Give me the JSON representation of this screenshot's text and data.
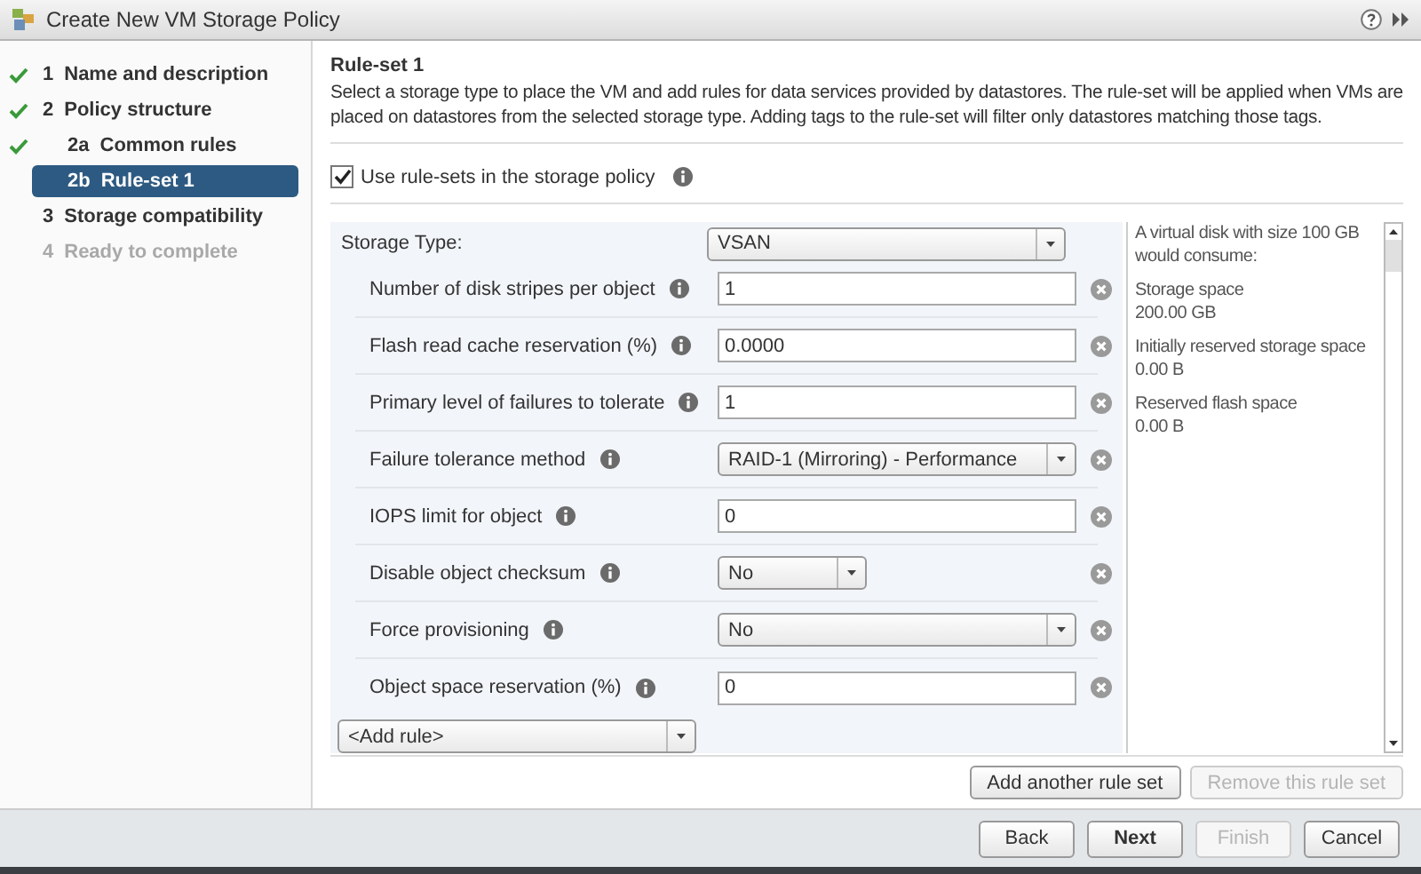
{
  "window": {
    "title": "Create New VM Storage Policy"
  },
  "steps": [
    {
      "number": "1",
      "label": "Name and description",
      "completed": true,
      "selected": false,
      "disabled": false
    },
    {
      "number": "2",
      "label": "Policy structure",
      "completed": true,
      "selected": false,
      "disabled": false,
      "children": [
        {
          "number": "2a",
          "label": "Common rules",
          "completed": true,
          "selected": false,
          "disabled": false
        },
        {
          "number": "2b",
          "label": "Rule-set 1",
          "completed": false,
          "selected": true,
          "disabled": false
        }
      ]
    },
    {
      "number": "3",
      "label": "Storage compatibility",
      "completed": false,
      "selected": false,
      "disabled": false
    },
    {
      "number": "4",
      "label": "Ready to complete",
      "completed": false,
      "selected": false,
      "disabled": true
    }
  ],
  "content": {
    "heading": "Rule-set 1",
    "description": "Select a storage type to place the VM and add rules for data services provided by datastores. The rule-set will be applied when VMs are placed on datastores from the selected storage type. Adding tags to the rule-set will filter only datastores matching those tags.",
    "use_rule_sets": {
      "label": "Use rule-sets in the storage policy",
      "checked": true
    },
    "storage_type": {
      "label": "Storage Type:",
      "value": "VSAN"
    },
    "rules": [
      {
        "kind": "input",
        "label": "Number of disk stripes per object",
        "value": "1"
      },
      {
        "kind": "input",
        "label": "Flash read cache reservation (%)",
        "value": "0.0000"
      },
      {
        "kind": "input",
        "label": "Primary level of failures to tolerate",
        "value": "1"
      },
      {
        "kind": "select",
        "label": "Failure tolerance method",
        "value": "RAID-1 (Mirroring) - Performance",
        "short": false
      },
      {
        "kind": "input",
        "label": "IOPS limit for object",
        "value": "0"
      },
      {
        "kind": "select",
        "label": "Disable object checksum",
        "value": "No",
        "short": true
      },
      {
        "kind": "select",
        "label": "Force provisioning",
        "value": "No",
        "short": false
      },
      {
        "kind": "input",
        "label": "Object space reservation (%)",
        "value": "0"
      }
    ],
    "add_rule": {
      "value": "<Add rule>"
    },
    "info": {
      "intro": "A virtual disk with size 100 GB would consume:",
      "items": [
        {
          "label": "Storage space",
          "value": "200.00 GB"
        },
        {
          "label": "Initially reserved storage space",
          "value": "0.00 B"
        },
        {
          "label": "Reserved flash space",
          "value": "0.00 B"
        }
      ]
    },
    "rule_set_buttons": [
      {
        "label": "Add another rule set",
        "disabled": false
      },
      {
        "label": "Remove this rule set",
        "disabled": true
      }
    ]
  },
  "footer_buttons": [
    {
      "label": "Back",
      "disabled": false,
      "primary": false
    },
    {
      "label": "Next",
      "disabled": false,
      "primary": true
    },
    {
      "label": "Finish",
      "disabled": true,
      "primary": false
    },
    {
      "label": "Cancel",
      "disabled": false,
      "primary": false
    }
  ]
}
